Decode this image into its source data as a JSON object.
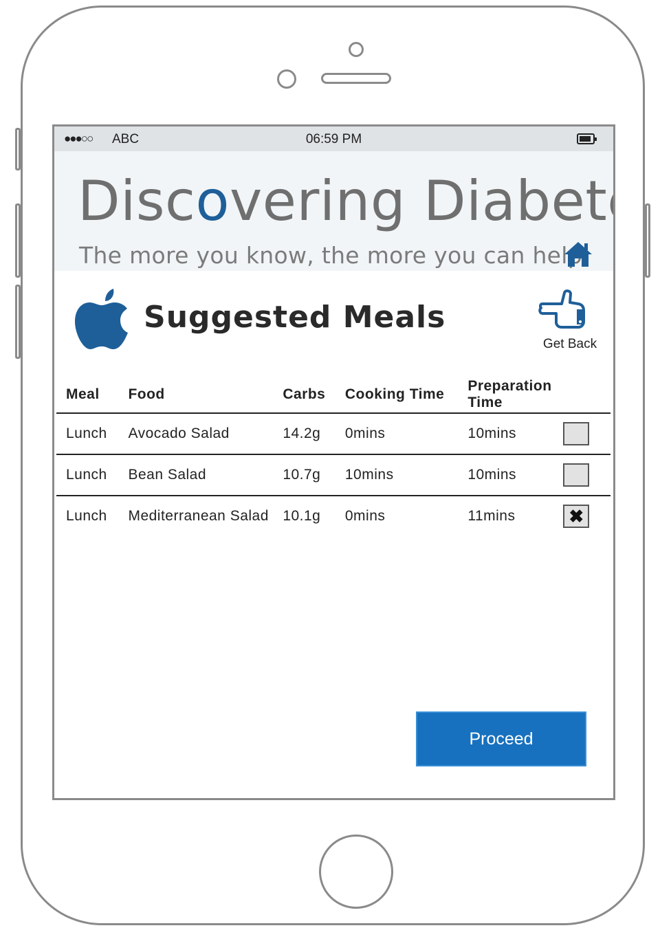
{
  "status_bar": {
    "signal": "●●●○○",
    "carrier": "ABC",
    "time": "06:59 PM"
  },
  "banner": {
    "title_part1": "Disc",
    "title_o": "o",
    "title_part2": "vering Diabetes",
    "subtitle": "The more you know, the more you can help."
  },
  "header": {
    "title": "Suggested Meals",
    "get_back_label": "Get Back"
  },
  "table": {
    "columns": [
      "Meal",
      "Food",
      "Carbs",
      "Cooking Time",
      "Preparation Time"
    ],
    "rows": [
      {
        "meal": "Lunch",
        "food": "Avocado Salad",
        "carbs": "14.2g",
        "cooking_time": "0mins",
        "preparation_time": "10mins",
        "checked": false
      },
      {
        "meal": "Lunch",
        "food": "Bean Salad",
        "carbs": "10.7g",
        "cooking_time": "10mins",
        "preparation_time": "10mins",
        "checked": false
      },
      {
        "meal": "Lunch",
        "food": "Mediterranean Salad",
        "carbs": "10.1g",
        "cooking_time": "0mins",
        "preparation_time": "11mins",
        "checked": true,
        "check_mark": "✖"
      }
    ]
  },
  "actions": {
    "proceed_label": "Proceed"
  },
  "colors": {
    "accent": "#1771bf",
    "brand_blue": "#1f5f99",
    "status_bar_bg": "#dfe3e6",
    "banner_bg": "#f1f5f7"
  },
  "icons": {
    "home": "home-icon",
    "apple": "apple-icon",
    "get_back": "pointing-hand-icon",
    "battery": "battery-icon"
  }
}
